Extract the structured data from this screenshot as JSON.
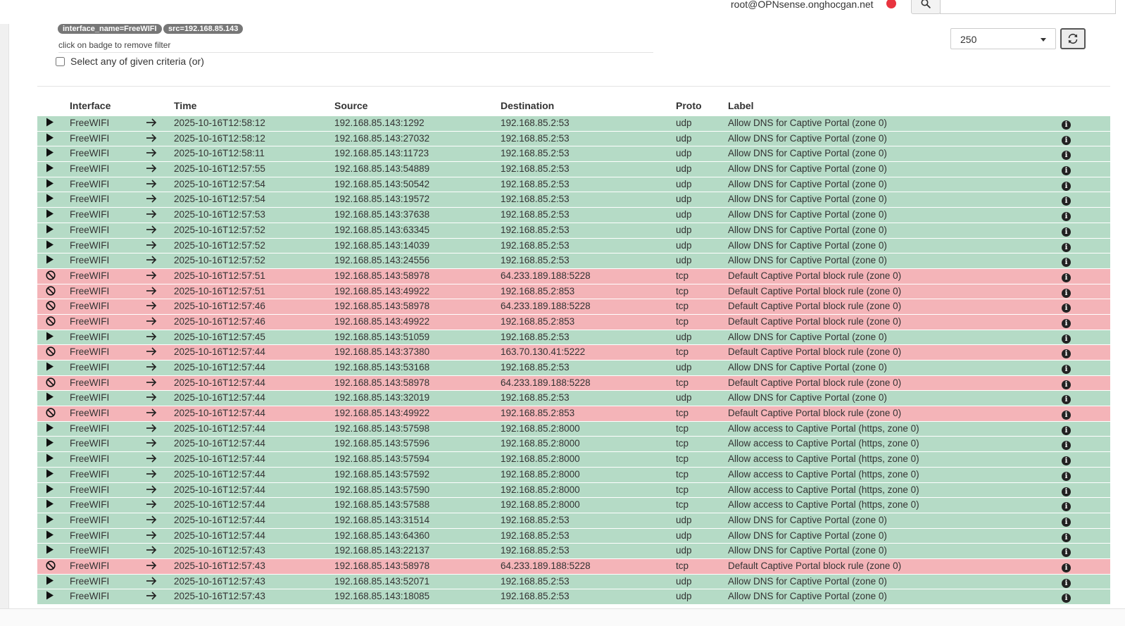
{
  "header": {
    "user": "root@OPNsense.onghocgan.net",
    "status_color": "#e8343f"
  },
  "filters": {
    "badges": [
      "interface_name=FreeWIFI",
      "src=192.168.85.143"
    ],
    "hint": "click on badge to remove filter",
    "or_label": "Select any of given criteria (or)",
    "or_checked": false
  },
  "controls": {
    "limit": "250"
  },
  "table": {
    "columns": [
      "Interface",
      "Time",
      "Source",
      "Destination",
      "Proto",
      "Label"
    ],
    "rows": [
      {
        "action": "pass",
        "iface": "FreeWIFI",
        "time": "2025-10-16T12:58:12",
        "src": "192.168.85.143:1292",
        "dst": "192.168.85.2:53",
        "proto": "udp",
        "label": "Allow DNS for Captive Portal (zone 0)"
      },
      {
        "action": "pass",
        "iface": "FreeWIFI",
        "time": "2025-10-16T12:58:12",
        "src": "192.168.85.143:27032",
        "dst": "192.168.85.2:53",
        "proto": "udp",
        "label": "Allow DNS for Captive Portal (zone 0)"
      },
      {
        "action": "pass",
        "iface": "FreeWIFI",
        "time": "2025-10-16T12:58:11",
        "src": "192.168.85.143:11723",
        "dst": "192.168.85.2:53",
        "proto": "udp",
        "label": "Allow DNS for Captive Portal (zone 0)"
      },
      {
        "action": "pass",
        "iface": "FreeWIFI",
        "time": "2025-10-16T12:57:55",
        "src": "192.168.85.143:54889",
        "dst": "192.168.85.2:53",
        "proto": "udp",
        "label": "Allow DNS for Captive Portal (zone 0)"
      },
      {
        "action": "pass",
        "iface": "FreeWIFI",
        "time": "2025-10-16T12:57:54",
        "src": "192.168.85.143:50542",
        "dst": "192.168.85.2:53",
        "proto": "udp",
        "label": "Allow DNS for Captive Portal (zone 0)"
      },
      {
        "action": "pass",
        "iface": "FreeWIFI",
        "time": "2025-10-16T12:57:54",
        "src": "192.168.85.143:19572",
        "dst": "192.168.85.2:53",
        "proto": "udp",
        "label": "Allow DNS for Captive Portal (zone 0)"
      },
      {
        "action": "pass",
        "iface": "FreeWIFI",
        "time": "2025-10-16T12:57:53",
        "src": "192.168.85.143:37638",
        "dst": "192.168.85.2:53",
        "proto": "udp",
        "label": "Allow DNS for Captive Portal (zone 0)"
      },
      {
        "action": "pass",
        "iface": "FreeWIFI",
        "time": "2025-10-16T12:57:52",
        "src": "192.168.85.143:63345",
        "dst": "192.168.85.2:53",
        "proto": "udp",
        "label": "Allow DNS for Captive Portal (zone 0)"
      },
      {
        "action": "pass",
        "iface": "FreeWIFI",
        "time": "2025-10-16T12:57:52",
        "src": "192.168.85.143:14039",
        "dst": "192.168.85.2:53",
        "proto": "udp",
        "label": "Allow DNS for Captive Portal (zone 0)"
      },
      {
        "action": "pass",
        "iface": "FreeWIFI",
        "time": "2025-10-16T12:57:52",
        "src": "192.168.85.143:24556",
        "dst": "192.168.85.2:53",
        "proto": "udp",
        "label": "Allow DNS for Captive Portal (zone 0)"
      },
      {
        "action": "block",
        "iface": "FreeWIFI",
        "time": "2025-10-16T12:57:51",
        "src": "192.168.85.143:58978",
        "dst": "64.233.189.188:5228",
        "proto": "tcp",
        "label": "Default Captive Portal block rule (zone 0)"
      },
      {
        "action": "block",
        "iface": "FreeWIFI",
        "time": "2025-10-16T12:57:51",
        "src": "192.168.85.143:49922",
        "dst": "192.168.85.2:853",
        "proto": "tcp",
        "label": "Default Captive Portal block rule (zone 0)"
      },
      {
        "action": "block",
        "iface": "FreeWIFI",
        "time": "2025-10-16T12:57:46",
        "src": "192.168.85.143:58978",
        "dst": "64.233.189.188:5228",
        "proto": "tcp",
        "label": "Default Captive Portal block rule (zone 0)"
      },
      {
        "action": "block",
        "iface": "FreeWIFI",
        "time": "2025-10-16T12:57:46",
        "src": "192.168.85.143:49922",
        "dst": "192.168.85.2:853",
        "proto": "tcp",
        "label": "Default Captive Portal block rule (zone 0)"
      },
      {
        "action": "pass",
        "iface": "FreeWIFI",
        "time": "2025-10-16T12:57:45",
        "src": "192.168.85.143:51059",
        "dst": "192.168.85.2:53",
        "proto": "udp",
        "label": "Allow DNS for Captive Portal (zone 0)"
      },
      {
        "action": "block",
        "iface": "FreeWIFI",
        "time": "2025-10-16T12:57:44",
        "src": "192.168.85.143:37380",
        "dst": "163.70.130.41:5222",
        "proto": "tcp",
        "label": "Default Captive Portal block rule (zone 0)"
      },
      {
        "action": "pass",
        "iface": "FreeWIFI",
        "time": "2025-10-16T12:57:44",
        "src": "192.168.85.143:53168",
        "dst": "192.168.85.2:53",
        "proto": "udp",
        "label": "Allow DNS for Captive Portal (zone 0)"
      },
      {
        "action": "block",
        "iface": "FreeWIFI",
        "time": "2025-10-16T12:57:44",
        "src": "192.168.85.143:58978",
        "dst": "64.233.189.188:5228",
        "proto": "tcp",
        "label": "Default Captive Portal block rule (zone 0)"
      },
      {
        "action": "pass",
        "iface": "FreeWIFI",
        "time": "2025-10-16T12:57:44",
        "src": "192.168.85.143:32019",
        "dst": "192.168.85.2:53",
        "proto": "udp",
        "label": "Allow DNS for Captive Portal (zone 0)"
      },
      {
        "action": "block",
        "iface": "FreeWIFI",
        "time": "2025-10-16T12:57:44",
        "src": "192.168.85.143:49922",
        "dst": "192.168.85.2:853",
        "proto": "tcp",
        "label": "Default Captive Portal block rule (zone 0)"
      },
      {
        "action": "pass",
        "iface": "FreeWIFI",
        "time": "2025-10-16T12:57:44",
        "src": "192.168.85.143:57598",
        "dst": "192.168.85.2:8000",
        "proto": "tcp",
        "label": "Allow access to Captive Portal (https, zone 0)"
      },
      {
        "action": "pass",
        "iface": "FreeWIFI",
        "time": "2025-10-16T12:57:44",
        "src": "192.168.85.143:57596",
        "dst": "192.168.85.2:8000",
        "proto": "tcp",
        "label": "Allow access to Captive Portal (https, zone 0)"
      },
      {
        "action": "pass",
        "iface": "FreeWIFI",
        "time": "2025-10-16T12:57:44",
        "src": "192.168.85.143:57594",
        "dst": "192.168.85.2:8000",
        "proto": "tcp",
        "label": "Allow access to Captive Portal (https, zone 0)"
      },
      {
        "action": "pass",
        "iface": "FreeWIFI",
        "time": "2025-10-16T12:57:44",
        "src": "192.168.85.143:57592",
        "dst": "192.168.85.2:8000",
        "proto": "tcp",
        "label": "Allow access to Captive Portal (https, zone 0)"
      },
      {
        "action": "pass",
        "iface": "FreeWIFI",
        "time": "2025-10-16T12:57:44",
        "src": "192.168.85.143:57590",
        "dst": "192.168.85.2:8000",
        "proto": "tcp",
        "label": "Allow access to Captive Portal (https, zone 0)"
      },
      {
        "action": "pass",
        "iface": "FreeWIFI",
        "time": "2025-10-16T12:57:44",
        "src": "192.168.85.143:57588",
        "dst": "192.168.85.2:8000",
        "proto": "tcp",
        "label": "Allow access to Captive Portal (https, zone 0)"
      },
      {
        "action": "pass",
        "iface": "FreeWIFI",
        "time": "2025-10-16T12:57:44",
        "src": "192.168.85.143:31514",
        "dst": "192.168.85.2:53",
        "proto": "udp",
        "label": "Allow DNS for Captive Portal (zone 0)"
      },
      {
        "action": "pass",
        "iface": "FreeWIFI",
        "time": "2025-10-16T12:57:44",
        "src": "192.168.85.143:64360",
        "dst": "192.168.85.2:53",
        "proto": "udp",
        "label": "Allow DNS for Captive Portal (zone 0)"
      },
      {
        "action": "pass",
        "iface": "FreeWIFI",
        "time": "2025-10-16T12:57:43",
        "src": "192.168.85.143:22137",
        "dst": "192.168.85.2:53",
        "proto": "udp",
        "label": "Allow DNS for Captive Portal (zone 0)"
      },
      {
        "action": "block",
        "iface": "FreeWIFI",
        "time": "2025-10-16T12:57:43",
        "src": "192.168.85.143:58978",
        "dst": "64.233.189.188:5228",
        "proto": "tcp",
        "label": "Default Captive Portal block rule (zone 0)"
      },
      {
        "action": "pass",
        "iface": "FreeWIFI",
        "time": "2025-10-16T12:57:43",
        "src": "192.168.85.143:52071",
        "dst": "192.168.85.2:53",
        "proto": "udp",
        "label": "Allow DNS for Captive Portal (zone 0)"
      },
      {
        "action": "pass",
        "iface": "FreeWIFI",
        "time": "2025-10-16T12:57:43",
        "src": "192.168.85.143:18085",
        "dst": "192.168.85.2:53",
        "proto": "udp",
        "label": "Allow DNS for Captive Portal (zone 0)"
      }
    ]
  },
  "colors": {
    "pass_row": "#b5dbc6",
    "block_row": "#f4b4b8"
  }
}
